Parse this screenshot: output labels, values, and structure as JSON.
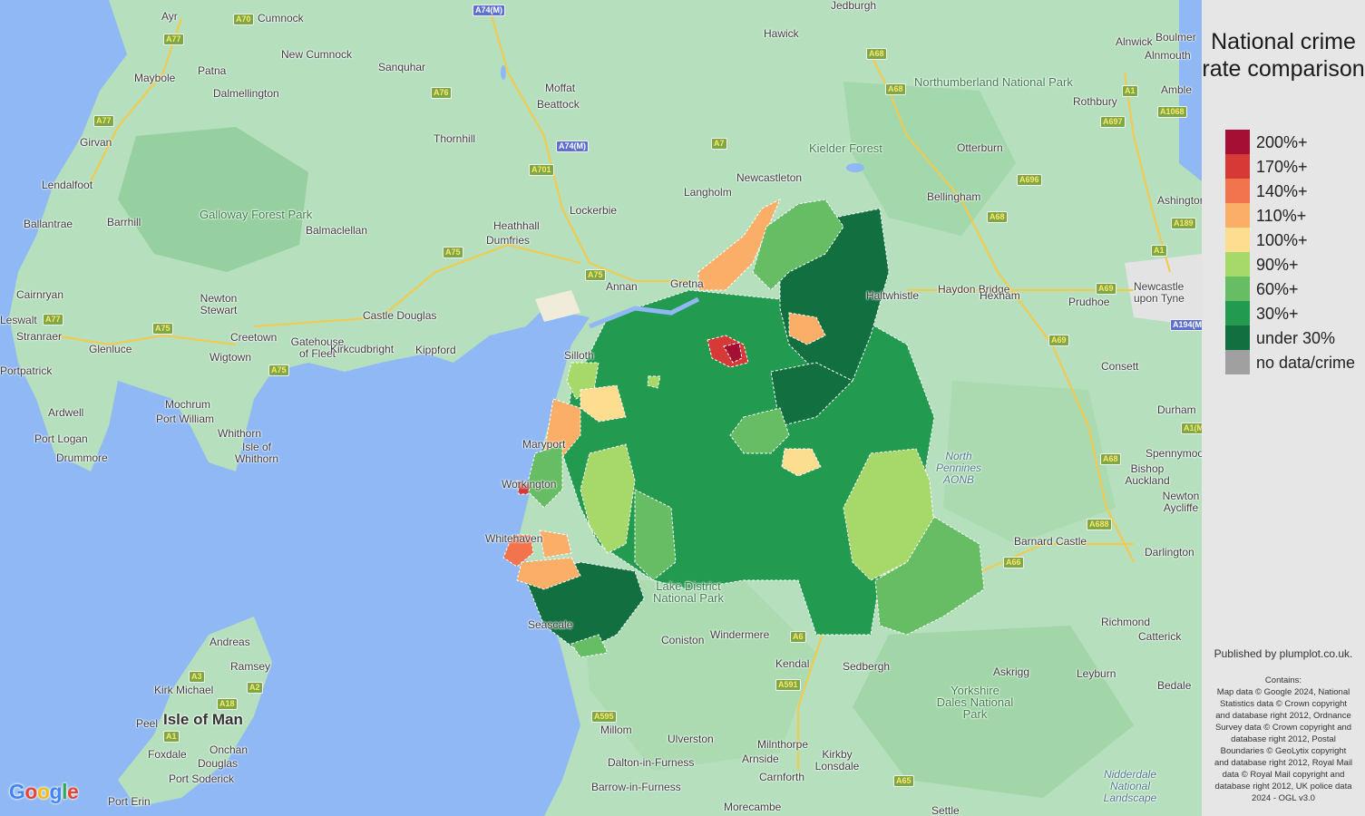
{
  "legend": {
    "title": "National crime rate comparison",
    "items": [
      {
        "label": "200%+",
        "color": "#a50f34"
      },
      {
        "label": "170%+",
        "color": "#d73a36"
      },
      {
        "label": "140%+",
        "color": "#f2744d"
      },
      {
        "label": "110%+",
        "color": "#fbae67"
      },
      {
        "label": "100%+",
        "color": "#fddd90"
      },
      {
        "label": "90%+",
        "color": "#a6d86a"
      },
      {
        "label": "60%+",
        "color": "#66bd63"
      },
      {
        "label": "30%+",
        "color": "#229a50"
      },
      {
        "label": "under 30%",
        "color": "#127040"
      },
      {
        "label": "no data/crime",
        "color": "#a0a0a0"
      }
    ]
  },
  "credits": {
    "published": "Published by plumplot.co.uk.",
    "contains_heading": "Contains:",
    "contains_text": "Map data © Google 2024, National Statistics data © Crown copyright and database right 2012, Ordnance Survey data © Crown copyright and database right 2012, Postal Boundaries © GeoLytix copyright and database right 2012, Royal Mail data © Royal Mail copyright and database right 2012, UK police data 2024 - OGL v3.0"
  },
  "google_logo": "Google",
  "places": [
    "Ayr",
    "Cumnock",
    "Jedburgh",
    "Hawick",
    "Alnwick",
    "Boulmer",
    "Alnmouth",
    "New Cumnock",
    "Sanquhar",
    "Maybole",
    "Patna",
    "Dalmellington",
    "Moffat",
    "Beattock",
    "Amble",
    "Northumberland National Park",
    "Rothbury",
    "Girvan",
    "Thornhill",
    "Kielder Forest",
    "Otterburn",
    "Lendalfoot",
    "Newcastleton",
    "Langholm",
    "Bellingham",
    "Ashington",
    "Galloway Forest Park",
    "Lockerbie",
    "Heathhall",
    "Dumfries",
    "Ballantrae",
    "Barrhill",
    "Balmaclellan",
    "Annan",
    "Gretna",
    "Haltwhistle",
    "Haydon Bridge",
    "Hexham",
    "Prudhoe",
    "Newcastle upon Tyne",
    "Cairnryan",
    "Newton Stewart",
    "Leswalt",
    "Stranraer",
    "Glenluce",
    "Creetown",
    "Castle Douglas",
    "Gatehouse of Fleet",
    "Wigtown",
    "Kirkcudbright",
    "Kippford",
    "Portpatrick",
    "Consett",
    "Mochrum",
    "Port William",
    "Durham",
    "Ardwell",
    "Whithorn",
    "Isle of Whithorn",
    "Port Logan",
    "Drummore",
    "North Pennines AONB",
    "Bishop Auckland",
    "Spennymoor",
    "Newton Aycliffe",
    "Barnard Castle",
    "Darlington",
    "Lake District National Park",
    "Richmond",
    "Catterick",
    "Andreas",
    "Ramsey",
    "Kirk Michael",
    "Isle of Man",
    "Peel",
    "Foxdale",
    "Onchan",
    "Douglas",
    "Port Soderick",
    "Port Erin",
    "Coniston",
    "Windermere",
    "Kendal",
    "Sedbergh",
    "Askrigg",
    "Leyburn",
    "Bedale",
    "Yorkshire Dales National Park",
    "Millom",
    "Ulverston",
    "Milnthorpe",
    "Arnside",
    "Kirkby Lonsdale",
    "Dalton-in-Furness",
    "Carnforth",
    "Barrow-in-Furness",
    "Morecambe",
    "Settle",
    "Nidderdale National Landscape",
    "Seascale",
    "Whitehaven",
    "Maryport",
    "Workington",
    "Silloth"
  ],
  "roads": [
    "A70",
    "A77",
    "A74(M)",
    "A68",
    "A76",
    "A1",
    "A1068",
    "A697",
    "A7",
    "A701",
    "A696",
    "A77",
    "A68",
    "A189",
    "A74(M)",
    "A75",
    "A1",
    "A69",
    "A77",
    "A75",
    "A75",
    "A75",
    "A69",
    "A194(M)",
    "A68",
    "A68",
    "A688",
    "A66",
    "A6",
    "A591",
    "A595",
    "A3",
    "A2",
    "A18",
    "A1",
    "A65",
    "A1(M)"
  ]
}
